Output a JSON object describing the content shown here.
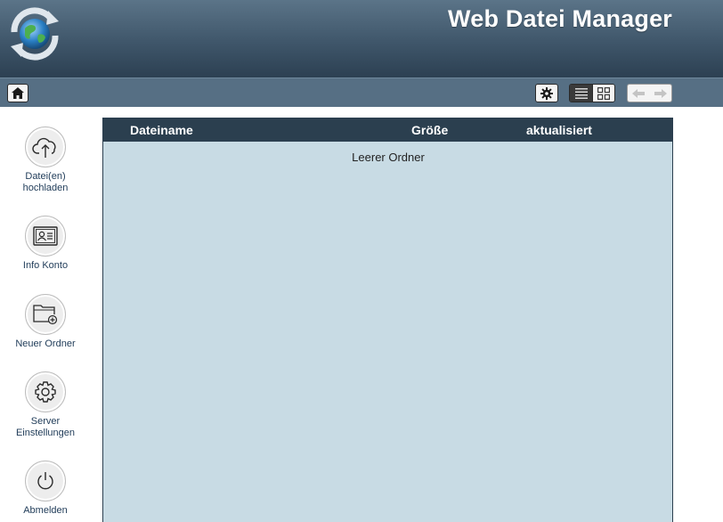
{
  "header": {
    "title": "Web Datei Manager",
    "logo_icon": "globe-sync-icon"
  },
  "toolbar": {
    "home_icon": "home-icon",
    "settings_icon": "gear-icon",
    "view_modes": [
      {
        "name": "list-view",
        "active": true
      },
      {
        "name": "grid-view",
        "active": false
      }
    ],
    "nav": [
      "back-arrow-icon",
      "forward-arrow-icon"
    ]
  },
  "sidebar": {
    "items": [
      {
        "label": "Datei(en)\nhochladen",
        "icon": "cloud-upload-icon"
      },
      {
        "label": "Info Konto",
        "icon": "id-card-icon"
      },
      {
        "label": "Neuer Ordner",
        "icon": "folder-add-icon"
      },
      {
        "label": "Server\nEinstellungen",
        "icon": "gear-icon"
      },
      {
        "label": "Abmelden",
        "icon": "power-icon"
      }
    ]
  },
  "table": {
    "columns": [
      "Dateiname",
      "Größe",
      "aktualisiert"
    ],
    "empty_message": "Leerer Ordner"
  },
  "colors": {
    "header_top": "#5b7488",
    "header_bottom": "#2c4052",
    "toolbar": "#566f84",
    "panel_bg": "#c8dbe4",
    "panel_header": "#2b3f4f",
    "sidebar_text": "#1f3b58"
  }
}
